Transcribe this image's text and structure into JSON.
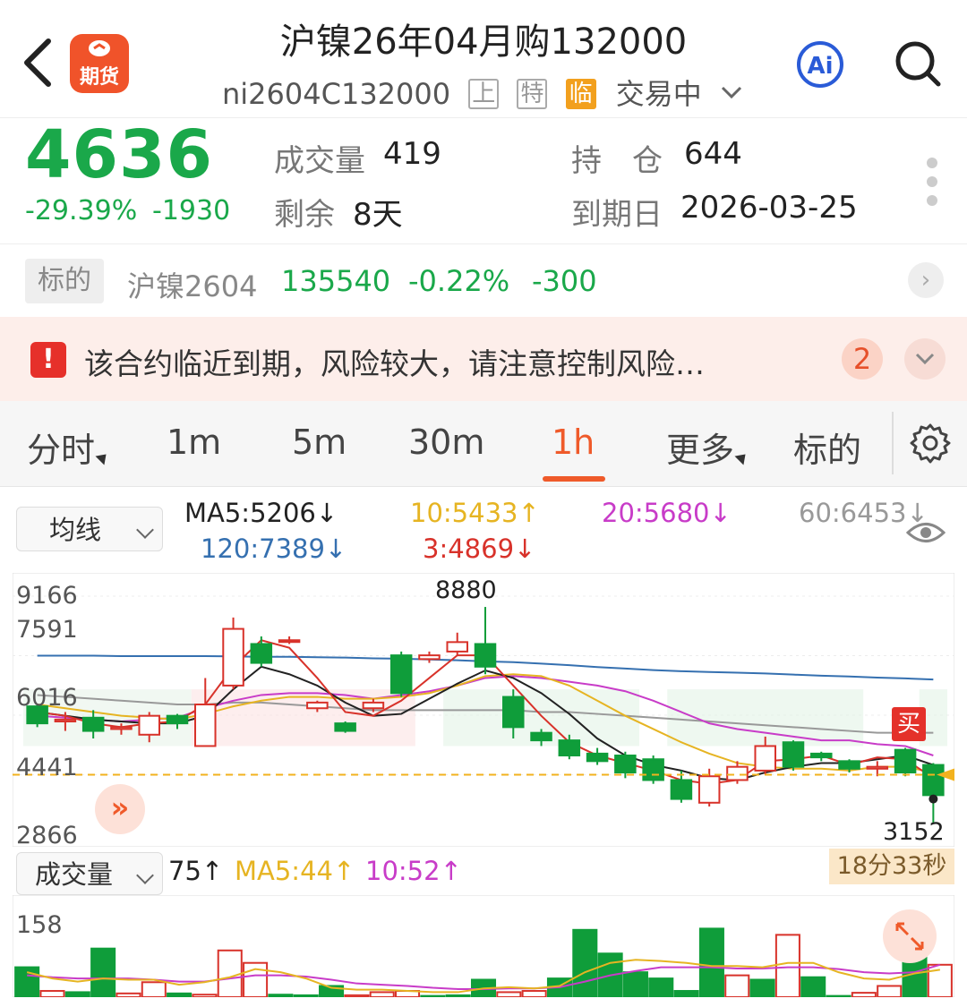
{
  "header": {
    "title": "沪镍26年04月购132000",
    "code": "ni2604C132000",
    "tags": [
      "上",
      "特",
      "临"
    ],
    "status": "交易中",
    "logo_text": "期货",
    "ai_label": "Ai"
  },
  "quote": {
    "price": "4636",
    "change_pct": "-29.39%",
    "change": "-1930",
    "volume_label": "成交量",
    "volume": "419",
    "open_interest_label": "持　仓",
    "open_interest": "644",
    "remaining_label": "剩余",
    "remaining": "8天",
    "expiry_label": "到期日",
    "expiry": "2026-03-25"
  },
  "underlying": {
    "badge": "标的",
    "name": "沪镍2604",
    "price": "135540",
    "change_pct": "-0.22%",
    "change": "-300"
  },
  "warning": {
    "text": "该合约临近到期，风险较大，请注意控制风险…",
    "count": "2"
  },
  "tabs": [
    {
      "label": "分时"
    },
    {
      "label": "1m"
    },
    {
      "label": "5m"
    },
    {
      "label": "30m"
    },
    {
      "label": "1h"
    },
    {
      "label": "更多"
    },
    {
      "label": "标的"
    }
  ],
  "active_tab": "1h",
  "ma_legend": {
    "selector": "均线",
    "ma5": "MA5:5206↓",
    "ma10": "10:5433↑",
    "ma20": "20:5680↓",
    "ma60": "60:6453↓",
    "ma120": "120:7389↓",
    "ma3": "3:4869↓"
  },
  "volume_legend": {
    "selector": "成交量",
    "vol": "75↑",
    "ma5": "MA5:44↑",
    "ma10": "10:52↑"
  },
  "countdown": "18分33秒",
  "buy_label": "买",
  "colors": {
    "up": "#d8322a",
    "down": "#0f9d3a",
    "accent": "#ef5a2a",
    "ma5": "#222222",
    "ma10": "#e6b422",
    "ma20": "#c83cc8",
    "ma60": "#999999",
    "ma120": "#3570b0",
    "ma3": "#d8322a"
  },
  "chart_data": {
    "type": "candlestick",
    "y_ticks": [
      "9166",
      "7591",
      "6016",
      "4441",
      "2866"
    ],
    "ylim": [
      2866,
      9166
    ],
    "annotations": {
      "high": "8880",
      "low": "3152",
      "last": "4441"
    },
    "candles": [
      {
        "o": 6250,
        "c": 5800,
        "h": 6300,
        "l": 5700
      },
      {
        "o": 5850,
        "c": 5900,
        "h": 6100,
        "l": 5600
      },
      {
        "o": 5950,
        "c": 5600,
        "h": 6150,
        "l": 5400
      },
      {
        "o": 5650,
        "c": 5700,
        "h": 5800,
        "l": 5500
      },
      {
        "o": 5500,
        "c": 6000,
        "h": 6100,
        "l": 5300
      },
      {
        "o": 6000,
        "c": 5800,
        "h": 6050,
        "l": 5650
      },
      {
        "o": 5200,
        "c": 6300,
        "h": 7000,
        "l": 5200
      },
      {
        "o": 6800,
        "c": 8300,
        "h": 8600,
        "l": 6700
      },
      {
        "o": 7900,
        "c": 7400,
        "h": 8100,
        "l": 7300
      },
      {
        "o": 8000,
        "c": 8000,
        "h": 8100,
        "l": 7900
      },
      {
        "o": 6200,
        "c": 6350,
        "h": 6400,
        "l": 6100
      },
      {
        "o": 5800,
        "c": 5600,
        "h": 5850,
        "l": 5550
      },
      {
        "o": 6200,
        "c": 6350,
        "h": 6450,
        "l": 6100
      },
      {
        "o": 7600,
        "c": 6600,
        "h": 7700,
        "l": 6500
      },
      {
        "o": 7500,
        "c": 7600,
        "h": 7700,
        "l": 7400
      },
      {
        "o": 7700,
        "c": 7950,
        "h": 8200,
        "l": 7600
      },
      {
        "o": 7900,
        "c": 7300,
        "h": 8880,
        "l": 7100
      },
      {
        "o": 6500,
        "c": 5700,
        "h": 6700,
        "l": 5400
      },
      {
        "o": 5550,
        "c": 5350,
        "h": 5650,
        "l": 5200
      },
      {
        "o": 5350,
        "c": 4950,
        "h": 5500,
        "l": 4850
      },
      {
        "o": 5000,
        "c": 4800,
        "h": 5150,
        "l": 4700
      },
      {
        "o": 4950,
        "c": 4500,
        "h": 5050,
        "l": 4350
      },
      {
        "o": 4850,
        "c": 4300,
        "h": 4950,
        "l": 4200
      },
      {
        "o": 4300,
        "c": 3800,
        "h": 4550,
        "l": 3700
      },
      {
        "o": 3700,
        "c": 4400,
        "h": 4600,
        "l": 3600
      },
      {
        "o": 4300,
        "c": 4650,
        "h": 4800,
        "l": 4200
      },
      {
        "o": 4550,
        "c": 5200,
        "h": 5450,
        "l": 4450
      },
      {
        "o": 5300,
        "c": 4650,
        "h": 5350,
        "l": 4550
      },
      {
        "o": 5000,
        "c": 4900,
        "h": 5050,
        "l": 4800
      },
      {
        "o": 4800,
        "c": 4600,
        "h": 4850,
        "l": 4500
      },
      {
        "o": 4600,
        "c": 4650,
        "h": 4800,
        "l": 4400
      },
      {
        "o": 5100,
        "c": 4500,
        "h": 5150,
        "l": 4400
      },
      {
        "o": 4700,
        "c": 3900,
        "h": 4750,
        "l": 3152
      }
    ],
    "ma5": [
      6100,
      6000,
      5900,
      5850,
      5800,
      5800,
      6000,
      6700,
      7300,
      7100,
      6800,
      6350,
      6000,
      6050,
      6450,
      6850,
      7200,
      7000,
      6600,
      6050,
      5400,
      4950,
      4700,
      4550,
      4350,
      4300,
      4500,
      4650,
      4750,
      4750,
      4850,
      4950,
      4700
    ],
    "ma10": [
      6300,
      6200,
      6100,
      6000,
      5950,
      5900,
      6050,
      6250,
      6400,
      6500,
      6500,
      6450,
      6450,
      6500,
      6600,
      6800,
      7050,
      7100,
      7050,
      6800,
      6400,
      6000,
      5650,
      5300,
      5000,
      4750,
      4650,
      4600,
      4600,
      4550,
      4650,
      4650,
      4500
    ],
    "ma20": [
      6000,
      5950,
      5900,
      5850,
      5900,
      5950,
      6200,
      6400,
      6550,
      6600,
      6600,
      6550,
      6450,
      6550,
      6650,
      6800,
      7000,
      7050,
      7000,
      6900,
      6800,
      6650,
      6400,
      6100,
      5800,
      5650,
      5550,
      5450,
      5350,
      5350,
      5250,
      5200,
      4950
    ],
    "ma60": [
      6550,
      6500,
      6450,
      6400,
      6350,
      6300,
      6300,
      6350,
      6350,
      6300,
      6250,
      6200,
      6150,
      6150,
      6150,
      6150,
      6150,
      6150,
      6100,
      6100,
      6050,
      6000,
      5950,
      5900,
      5850,
      5800,
      5750,
      5700,
      5650,
      5600,
      5550,
      5550,
      5550
    ],
    "ma120": [
      7590,
      7590,
      7590,
      7580,
      7580,
      7580,
      7580,
      7570,
      7560,
      7560,
      7550,
      7540,
      7520,
      7510,
      7490,
      7470,
      7440,
      7420,
      7380,
      7340,
      7290,
      7250,
      7210,
      7180,
      7160,
      7140,
      7120,
      7090,
      7060,
      7040,
      7010,
      6990,
      6960
    ],
    "ma3": [
      6100,
      6000,
      5800,
      5700,
      5800,
      5850,
      6300,
      7300,
      8000,
      7800,
      7000,
      6100,
      6000,
      6400,
      7000,
      7600,
      7600,
      6800,
      6000,
      5300,
      4950,
      4750,
      4550,
      4300,
      4200,
      4300,
      4800,
      4850,
      4950,
      4700,
      4900,
      4850,
      4350
    ],
    "volume": {
      "ylim": [
        0,
        158
      ],
      "top_label": "158",
      "values": [
        48,
        10,
        8,
        78,
        6,
        24,
        6,
        4,
        75,
        55,
        4,
        3,
        18,
        3,
        8,
        10,
        2,
        3,
        28,
        8,
        10,
        30,
        108,
        70,
        40,
        30,
        10,
        110,
        35,
        28,
        100,
        32,
        2,
        7,
        18,
        68,
        52
      ],
      "up": [
        false,
        true,
        false,
        false,
        true,
        true,
        false,
        true,
        true,
        true,
        false,
        false,
        false,
        true,
        true,
        true,
        false,
        false,
        false,
        true,
        true,
        false,
        false,
        false,
        false,
        false,
        false,
        false,
        true,
        false,
        true,
        false,
        false,
        true,
        true,
        false,
        true
      ],
      "ma5": [
        40,
        30,
        25,
        30,
        28,
        28,
        20,
        24,
        32,
        45,
        40,
        30,
        15,
        12,
        12,
        10,
        8,
        8,
        14,
        16,
        14,
        18,
        40,
        55,
        60,
        58,
        55,
        50,
        50,
        48,
        55,
        55,
        40,
        30,
        28,
        38,
        44
      ],
      "ma10": [
        35,
        32,
        30,
        30,
        30,
        28,
        25,
        25,
        30,
        35,
        35,
        33,
        28,
        22,
        20,
        18,
        15,
        13,
        13,
        14,
        14,
        16,
        25,
        35,
        42,
        48,
        48,
        48,
        46,
        46,
        48,
        48,
        45,
        40,
        38,
        40,
        52
      ]
    }
  }
}
